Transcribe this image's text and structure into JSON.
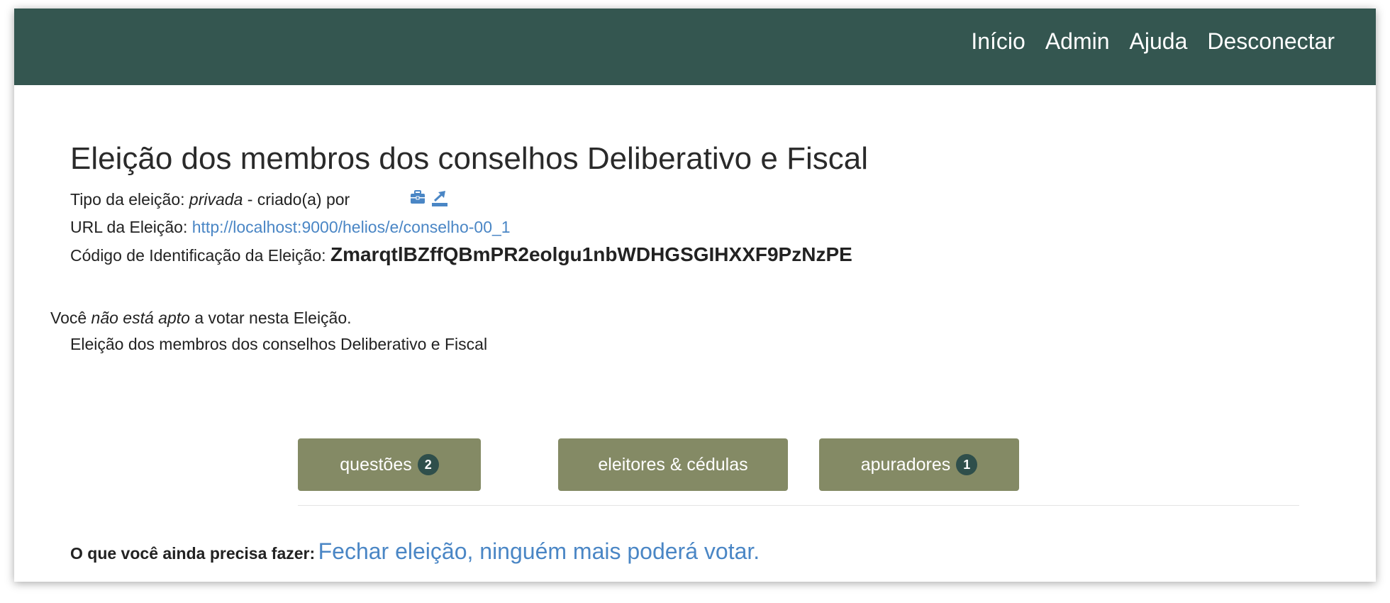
{
  "nav": {
    "items": [
      "Início",
      "Admin",
      "Ajuda",
      "Desconectar"
    ]
  },
  "election": {
    "title": "Eleição dos membros dos conselhos Deliberativo e Fiscal",
    "type_label": "Tipo da eleição:",
    "type_value": "privada",
    "created_by": "- criado(a) por",
    "url_label": "URL da Eleição:",
    "url_value": "http://localhost:9000/helios/e/conselho-00_1",
    "code_label": "Código de Identificação da Eleição:",
    "code_value": "ZmarqtlBZffQBmPR2eolgu1nbWDHGSGIHXXF9PzNzPE"
  },
  "eligibility": {
    "prefix": "Você",
    "emphasis": "não está apto",
    "suffix": "a votar nesta Eleição.",
    "subtitle": "Eleição dos membros dos conselhos Deliberativo e Fiscal"
  },
  "buttons": {
    "questions": {
      "label": "questões",
      "count": "2"
    },
    "voters": {
      "label": "eleitores & cédulas"
    },
    "trustees": {
      "label": "apuradores",
      "count": "1"
    }
  },
  "todo": {
    "label": "O que você ainda precisa fazer:",
    "action": "Fechar eleição, ninguém mais poderá votar."
  },
  "icons": {
    "briefcase": "briefcase-icon",
    "export": "export-icon"
  },
  "colors": {
    "navbar": "#345650",
    "button": "#848a65",
    "badge": "#2f4f4b",
    "link": "#4a86c5"
  }
}
